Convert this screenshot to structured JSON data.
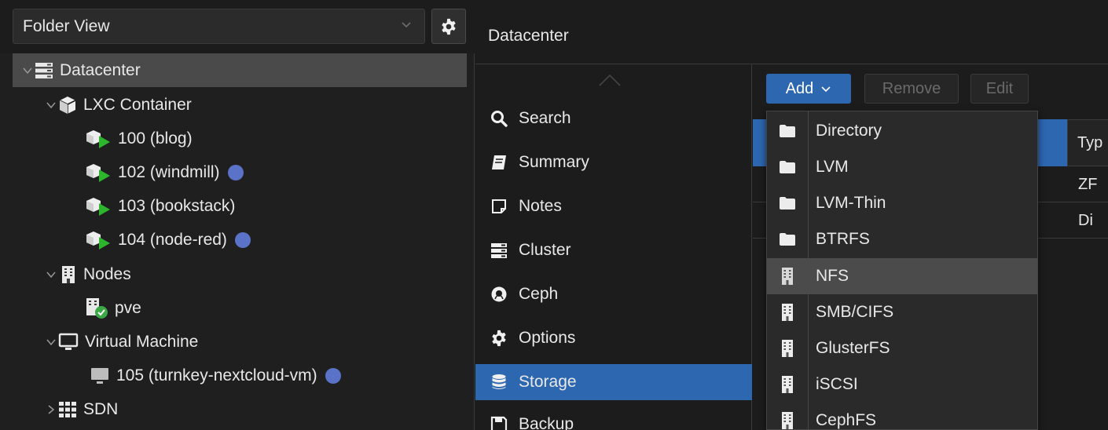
{
  "left": {
    "view_selector": "Folder View",
    "tree": [
      {
        "label": "Datacenter",
        "icon": "server-rack-icon",
        "selected": true
      },
      {
        "label": "LXC Container",
        "icon": "cube-icon"
      },
      {
        "label": "100 (blog)",
        "icon": "container-running-icon"
      },
      {
        "label": "102 (windmill)",
        "icon": "container-running-icon",
        "tag": true
      },
      {
        "label": "103 (bookstack)",
        "icon": "container-running-icon"
      },
      {
        "label": "104 (node-red)",
        "icon": "container-running-icon",
        "tag": true
      },
      {
        "label": "Nodes",
        "icon": "building-icon"
      },
      {
        "label": "pve",
        "icon": "node-online-icon"
      },
      {
        "label": "Virtual Machine",
        "icon": "monitor-icon"
      },
      {
        "label": "105 (turnkey-nextcloud-vm)",
        "icon": "vm-stopped-icon",
        "tag": true
      },
      {
        "label": "SDN",
        "icon": "grid-icon"
      }
    ]
  },
  "breadcrumb": "Datacenter",
  "nav": {
    "items": [
      {
        "label": "Search",
        "icon": "search-icon"
      },
      {
        "label": "Summary",
        "icon": "book-icon"
      },
      {
        "label": "Notes",
        "icon": "note-icon"
      },
      {
        "label": "Cluster",
        "icon": "server-rack-icon"
      },
      {
        "label": "Ceph",
        "icon": "ceph-icon"
      },
      {
        "label": "Options",
        "icon": "gear-icon"
      },
      {
        "label": "Storage",
        "icon": "database-icon",
        "active": true
      },
      {
        "label": "Backup",
        "icon": "floppy-icon"
      }
    ]
  },
  "toolbar": {
    "add_label": "Add",
    "remove_label": "Remove",
    "edit_label": "Edit"
  },
  "grid": {
    "col_type": "Typ",
    "rows": [
      "ZF",
      "Di"
    ]
  },
  "add_menu": {
    "items": [
      {
        "label": "Directory",
        "icon": "folder-icon"
      },
      {
        "label": "LVM",
        "icon": "folder-icon"
      },
      {
        "label": "LVM-Thin",
        "icon": "folder-icon"
      },
      {
        "label": "BTRFS",
        "icon": "folder-icon"
      },
      {
        "label": "NFS",
        "icon": "building-icon",
        "highlighted": true
      },
      {
        "label": "SMB/CIFS",
        "icon": "building-icon"
      },
      {
        "label": "GlusterFS",
        "icon": "building-icon"
      },
      {
        "label": "iSCSI",
        "icon": "building-icon"
      },
      {
        "label": "CephFS",
        "icon": "building-icon"
      }
    ]
  },
  "colors": {
    "accent": "#2c67b0",
    "tag": "#5a73c9",
    "running": "#2eb52e",
    "online": "#3aa845"
  }
}
